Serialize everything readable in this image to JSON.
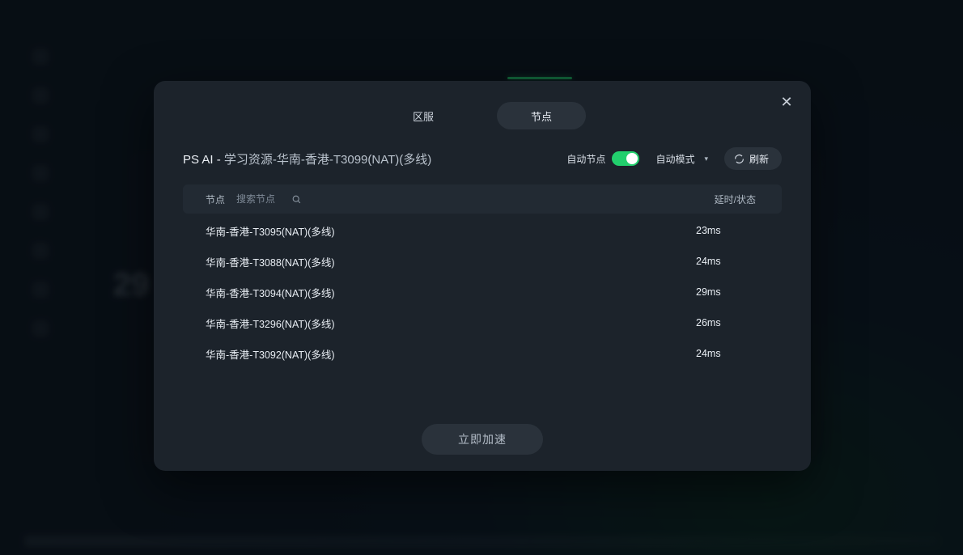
{
  "tabs": {
    "zone": "区服",
    "node": "节点",
    "active": "node"
  },
  "title": {
    "prefix": "PS AI - ",
    "rest": "学习资源-华南-香港-T3099(NAT)(多线)"
  },
  "controls": {
    "auto_node_label": "自动节点",
    "auto_node_on": true,
    "mode_label": "自动模式",
    "refresh_label": "刷新"
  },
  "table": {
    "col_node_label": "节点",
    "search_placeholder": "搜索节点",
    "col_latency_label": "延时/状态",
    "rows": [
      {
        "name": "华南-香港-T3095(NAT)(多线)",
        "latency": "23ms"
      },
      {
        "name": "华南-香港-T3088(NAT)(多线)",
        "latency": "24ms"
      },
      {
        "name": "华南-香港-T3094(NAT)(多线)",
        "latency": "29ms"
      },
      {
        "name": "华南-香港-T3296(NAT)(多线)",
        "latency": "26ms"
      },
      {
        "name": "华南-香港-T3092(NAT)(多线)",
        "latency": "24ms"
      }
    ]
  },
  "footer": {
    "accelerate_label": "立即加速"
  },
  "background": {
    "big_number": "29"
  }
}
